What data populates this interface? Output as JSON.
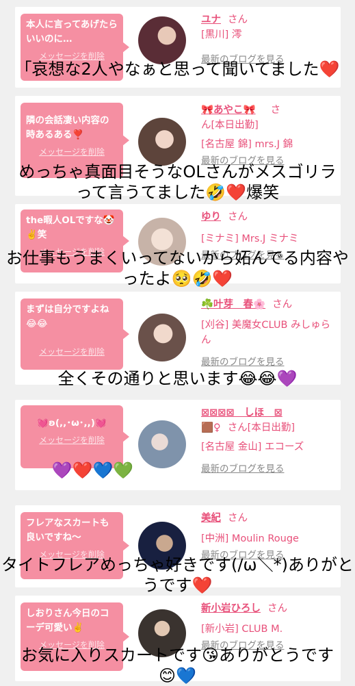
{
  "cards": [
    {
      "message": "本人に言ってあげたらいいのに…",
      "delete": "メッセージを削除",
      "name": "ユナ",
      "san": "さん",
      "shop": "[黒川] 澪",
      "blog": "最新のブログを見る",
      "avatar_color": "#4a2430"
    },
    {
      "message": "隣の会話凄い内容の時あるある❣️",
      "delete": "メッセージを削除",
      "name": "🎀あやこ🎀",
      "san": "さ",
      "shop_line1": "ん[本日出勤]",
      "shop": "[名古屋 錦] mrs.J 錦",
      "blog": "最新のブログを見る",
      "avatar_color": "#6b4f47"
    },
    {
      "message": "the暇人OLですな🤡✌️笑",
      "delete": "メッセージを削除",
      "name": "ゆり",
      "san": "さん",
      "shop": "[ミナミ] Mrs.J ミナミ",
      "blog": "最新のブログを見る",
      "avatar_color": "#d8c8bf"
    },
    {
      "message": "まずは自分ですよね😂😂",
      "delete": "メッセージを削除",
      "name": "☘️叶芽　春🌸",
      "san": "さん",
      "shop": "[刈谷] 美魔女CLUB みしゅらん",
      "blog": "最新のブログを見る",
      "avatar_color": "#8a6e66"
    },
    {
      "message": "💓ʚ(,,･ω･,,)💓",
      "delete": "メッセージを削除",
      "name": "⊠⊠⊠⊠　しほ　⊠",
      "san": "さん[本日出勤]",
      "name_prefix": "🟫♀",
      "shop": "[名古屋 金山] エコーズ",
      "blog": "最新のブログを見る",
      "avatar_color": "#9fb0c4"
    },
    {
      "message": "フレアなスカートも良いですね〜",
      "delete": "メッセージを削除",
      "name": "美紀",
      "san": "さん",
      "shop": "[中洲] Moulin Rouge",
      "blog": "最新のブログを見る",
      "avatar_color": "#1c2240"
    },
    {
      "message": "しおりさん今日のコーデ可愛い✌️",
      "delete": "メッセージを削除",
      "name": "新小岩ひろし",
      "san": "さん",
      "shop": "[新小岩] CLUB M.",
      "blog": "最新のブログを見る",
      "avatar_color": "#3b3531"
    }
  ],
  "replies": [
    "「哀想な2人やなぁと思って聞いてました❤️",
    "めっちゃ真面目そうなOLさんがメスゴリラって言うてました🤣❤️爆笑",
    "お仕事もうまくいってないから妬んでる内容やったよ🥺🤣❤️",
    "全くその通りと思います😂😂💜",
    "💜❤️💙💚",
    "タイトフレアめっちゃ好きです(/ω＼*)ありがとうです❤️",
    "お気に入りスカートです😘ありがとうです😊💙"
  ]
}
